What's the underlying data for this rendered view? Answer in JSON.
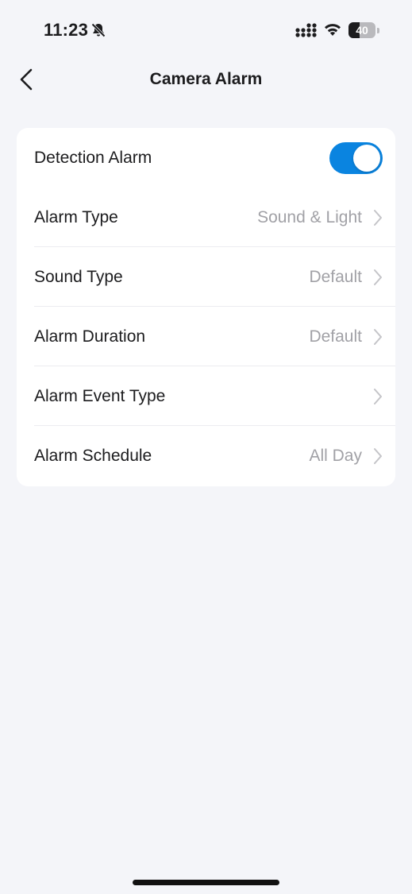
{
  "status_bar": {
    "time": "11:23",
    "battery_level": "40",
    "battery_fraction": 0.4,
    "icons": [
      "bell-slash-icon",
      "signal-icon",
      "wifi-icon",
      "battery-icon"
    ]
  },
  "nav": {
    "title": "Camera Alarm",
    "back_icon": "chevron-left-icon"
  },
  "settings": {
    "detection_alarm": {
      "label": "Detection Alarm",
      "enabled": true
    },
    "items": [
      {
        "label": "Alarm Type",
        "value": "Sound & Light"
      },
      {
        "label": "Sound Type",
        "value": "Default"
      },
      {
        "label": "Alarm Duration",
        "value": "Default"
      },
      {
        "label": "Alarm Event Type",
        "value": ""
      },
      {
        "label": "Alarm Schedule",
        "value": "All Day"
      }
    ]
  },
  "colors": {
    "accent": "#0a84e0",
    "background": "#f4f5f9",
    "card": "#ffffff",
    "secondary_text": "#a1a1a6"
  }
}
